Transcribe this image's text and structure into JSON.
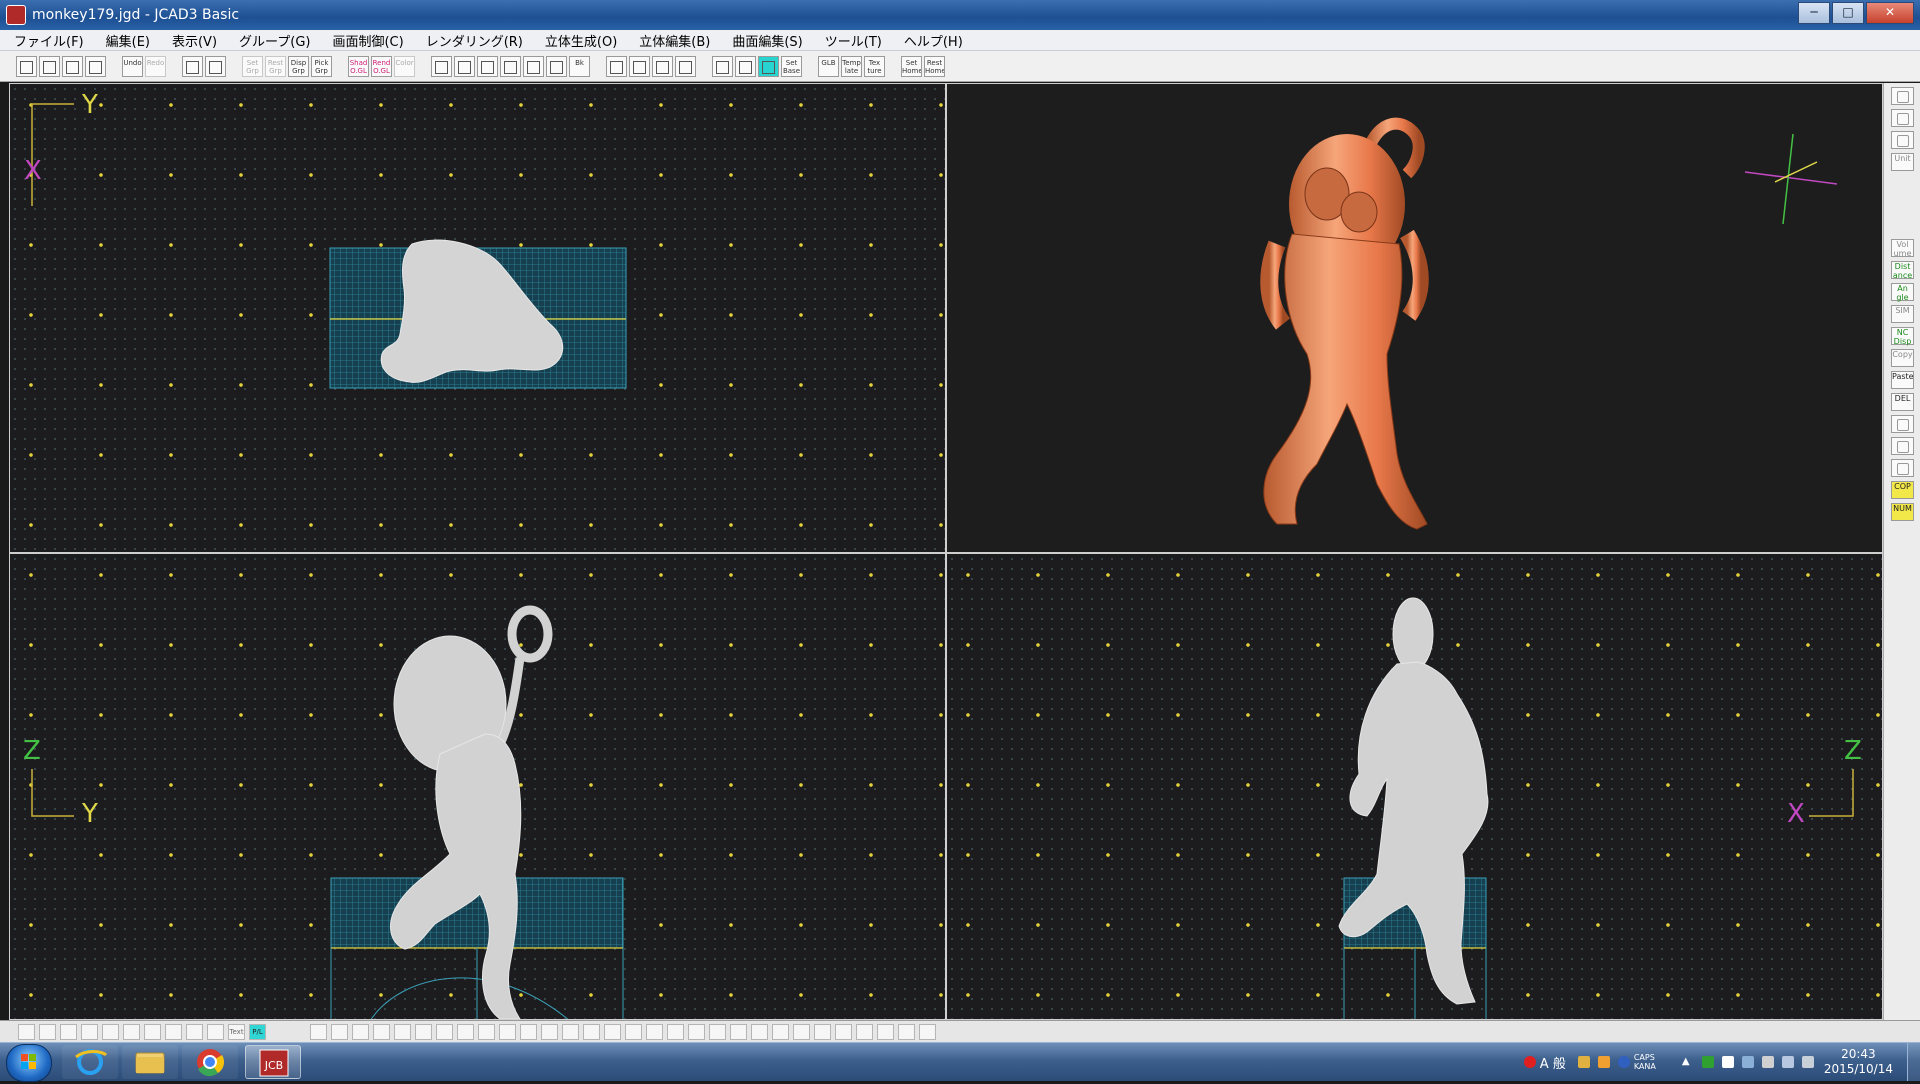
{
  "window": {
    "title": "monkey179.jgd - JCAD3 Basic",
    "controls": [
      "─",
      "□",
      "✕"
    ]
  },
  "menu": [
    "ファイル(F)",
    "編集(E)",
    "表示(V)",
    "グループ(G)",
    "画面制御(C)",
    "レンダリング(R)",
    "立体生成(O)",
    "立体編集(B)",
    "曲面編集(S)",
    "ツール(T)",
    "ヘルプ(H)"
  ],
  "toolbar": {
    "groups": [
      [
        {
          "icon": "new-file-icon"
        },
        {
          "icon": "open-folder-icon"
        },
        {
          "icon": "save-icon"
        },
        {
          "icon": "print-icon"
        }
      ],
      [
        {
          "icon": "undo-icon",
          "label": "Undo"
        },
        {
          "icon": "redo-icon",
          "label": "Redo",
          "dim": true
        }
      ],
      [
        {
          "icon": "copy-grid-icon"
        },
        {
          "icon": "grid-icon"
        }
      ],
      [
        {
          "icon": "set-group-icon",
          "label": "Set Grp",
          "dim": true
        },
        {
          "icon": "reset-group-icon",
          "label": "Rest Grp",
          "dim": true
        },
        {
          "icon": "display-group-icon",
          "label": "Disp Grp"
        },
        {
          "icon": "pick-group-icon",
          "label": "Pick Grp"
        }
      ],
      [
        {
          "icon": "shade-ogl-icon",
          "label": "Shad O.GL",
          "pink": true
        },
        {
          "icon": "rend-ogl-icon",
          "label": "Rend O.GL",
          "pink": true
        },
        {
          "icon": "color-icon",
          "label": "Color",
          "dim": true
        }
      ],
      [
        {
          "icon": "zoom-in-icon"
        },
        {
          "icon": "zoom-out-icon"
        },
        {
          "icon": "zoom-window-icon"
        },
        {
          "icon": "zoom-all-icon"
        },
        {
          "icon": "zoom-fit-icon"
        },
        {
          "icon": "pan-hand-icon"
        },
        {
          "icon": "back-icon",
          "label": "Bk"
        }
      ],
      [
        {
          "icon": "zoom-prev-icon"
        },
        {
          "icon": "zoom-next-icon"
        },
        {
          "icon": "zoom-realtime-icon"
        },
        {
          "icon": "zoom-extent-icon"
        }
      ],
      [
        {
          "icon": "grid-dots-icon"
        },
        {
          "icon": "grid-fine-icon"
        },
        {
          "icon": "grid-active-icon",
          "active": true
        },
        {
          "icon": "set-base-icon",
          "label": "Set Base"
        }
      ],
      [
        {
          "icon": "glb-icon",
          "label": "GLB"
        },
        {
          "icon": "template-icon",
          "label": "Temp late"
        },
        {
          "icon": "texture-icon",
          "label": "Tex ture"
        }
      ],
      [
        {
          "icon": "set-home-icon",
          "label": "Set Home"
        },
        {
          "icon": "rest-home-icon",
          "label": "Rest Home"
        }
      ]
    ]
  },
  "viewports": {
    "top": {
      "axis_h": "Y",
      "axis_v": "X",
      "view": "top"
    },
    "perspective": {
      "view": "perspective",
      "model_color": "#f0875a"
    },
    "front": {
      "axis_h": "Y",
      "axis_v": "Z",
      "view": "front"
    },
    "side": {
      "axis_h": "X",
      "axis_v": "Z",
      "view": "side"
    }
  },
  "colors": {
    "grid_dot": "#e3d23a",
    "grid_mesh": "#2e8aa0",
    "wireframe": "#d0d0d0",
    "axis_frame": "#c8b23a",
    "axis_x": "#c048c0",
    "axis_y": "#e0d848",
    "axis_z": "#44c044"
  },
  "right_toolbar": [
    {
      "icon": "light-icon"
    },
    {
      "icon": "camera-icon"
    },
    {
      "icon": "view-icon"
    },
    {
      "label": "Unit"
    },
    {
      "gap": true
    },
    {
      "label": "Vol ume"
    },
    {
      "label": "Dist ance",
      "color": "green"
    },
    {
      "label": "An gle",
      "color": "green"
    },
    {
      "label": "SIM"
    },
    {
      "label": "NC Disp",
      "color": "green"
    },
    {
      "label": "Copy"
    },
    {
      "label": "Paste",
      "color": "dark"
    },
    {
      "label": "DEL",
      "color": "dark"
    },
    {
      "icon": "sub-icon"
    },
    {
      "icon": "hammer-icon"
    },
    {
      "icon": "tree-icon",
      "color": "dark"
    },
    {
      "label": "COP",
      "color": "yellow"
    },
    {
      "label": "NUM",
      "color": "yellow"
    }
  ],
  "bottom_toolbar": {
    "buttons": 42,
    "labels": [
      "Text",
      "P/L"
    ]
  },
  "taskbar": {
    "apps": [
      {
        "name": "internet-explorer-icon"
      },
      {
        "name": "file-explorer-icon"
      },
      {
        "name": "chrome-icon"
      },
      {
        "name": "jcad-icon",
        "label": "JCB",
        "active": true
      }
    ],
    "ime": "A 般",
    "caps": "CAPS KANA",
    "time": "20:43",
    "date": "2015/10/14"
  }
}
